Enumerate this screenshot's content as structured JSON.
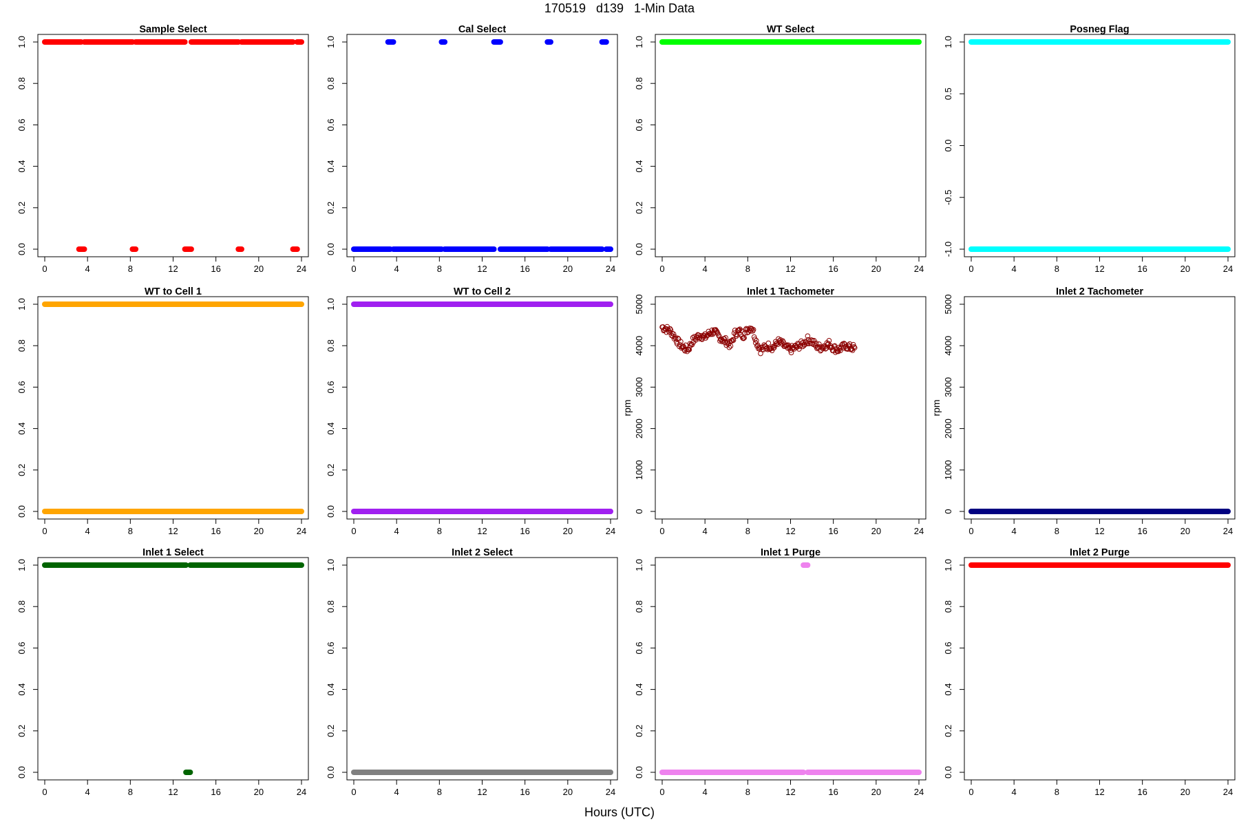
{
  "page": {
    "title": "170519   d139   1-Min Data",
    "xlabel": "Hours (UTC)"
  },
  "chart_data": [
    {
      "type": "scatter",
      "title": "Sample Select",
      "color": "#ff0000",
      "xlim": [
        0,
        24
      ],
      "ylim": [
        0,
        1
      ],
      "xticks": [
        0,
        4,
        8,
        12,
        16,
        20,
        24
      ],
      "yticks": [
        "0.0",
        "0.2",
        "0.4",
        "0.6",
        "0.8",
        "1.0"
      ],
      "ylabel": "",
      "series": [
        {
          "y": 1,
          "ranges": [
            [
              0,
              3.4
            ],
            [
              3.7,
              8.2
            ],
            [
              8.5,
              13.1
            ],
            [
              13.7,
              18.1
            ],
            [
              18.4,
              23.2
            ],
            [
              23.6,
              24
            ]
          ]
        },
        {
          "y": 0,
          "ranges": [
            [
              3.2,
              3.7
            ],
            [
              8.2,
              8.5
            ],
            [
              13.1,
              13.7
            ],
            [
              18.1,
              18.4
            ],
            [
              23.2,
              23.6
            ]
          ]
        }
      ]
    },
    {
      "type": "scatter",
      "title": "Cal Select",
      "color": "#0000ff",
      "xlim": [
        0,
        24
      ],
      "ylim": [
        0,
        1
      ],
      "xticks": [
        0,
        4,
        8,
        12,
        16,
        20,
        24
      ],
      "yticks": [
        "0.0",
        "0.2",
        "0.4",
        "0.6",
        "0.8",
        "1.0"
      ],
      "ylabel": "",
      "series": [
        {
          "y": 1,
          "ranges": [
            [
              3.2,
              3.7
            ],
            [
              8.2,
              8.5
            ],
            [
              13.1,
              13.7
            ],
            [
              18.1,
              18.4
            ],
            [
              23.2,
              23.6
            ]
          ]
        },
        {
          "y": 0,
          "ranges": [
            [
              0,
              3.4
            ],
            [
              3.7,
              8.2
            ],
            [
              8.5,
              13.1
            ],
            [
              13.7,
              18.1
            ],
            [
              18.4,
              23.2
            ],
            [
              23.6,
              24
            ]
          ]
        }
      ]
    },
    {
      "type": "scatter",
      "title": "WT Select",
      "color": "#00ff00",
      "xlim": [
        0,
        24
      ],
      "ylim": [
        0,
        1
      ],
      "xticks": [
        0,
        4,
        8,
        12,
        16,
        20,
        24
      ],
      "yticks": [
        "0.0",
        "0.2",
        "0.4",
        "0.6",
        "0.8",
        "1.0"
      ],
      "ylabel": "",
      "series": [
        {
          "y": 1,
          "ranges": [
            [
              0,
              24
            ]
          ]
        }
      ]
    },
    {
      "type": "scatter",
      "title": "Posneg Flag",
      "color": "#00ffff",
      "xlim": [
        0,
        24
      ],
      "ylim": [
        -1,
        1
      ],
      "xticks": [
        0,
        4,
        8,
        12,
        16,
        20,
        24
      ],
      "yticks": [
        "-1.0",
        "-0.5",
        "0.0",
        "0.5",
        "1.0"
      ],
      "ylabel": "",
      "series": [
        {
          "y": 1,
          "ranges": [
            [
              0,
              24
            ]
          ]
        },
        {
          "y": -1,
          "ranges": [
            [
              0,
              24
            ]
          ]
        }
      ]
    },
    {
      "type": "scatter",
      "title": "WT to Cell 1",
      "color": "#ffa500",
      "xlim": [
        0,
        24
      ],
      "ylim": [
        0,
        1
      ],
      "xticks": [
        0,
        4,
        8,
        12,
        16,
        20,
        24
      ],
      "yticks": [
        "0.0",
        "0.2",
        "0.4",
        "0.6",
        "0.8",
        "1.0"
      ],
      "ylabel": "",
      "series": [
        {
          "y": 1,
          "ranges": [
            [
              0,
              24
            ]
          ]
        },
        {
          "y": 0,
          "ranges": [
            [
              0,
              24
            ]
          ]
        }
      ]
    },
    {
      "type": "scatter",
      "title": "WT to Cell 2",
      "color": "#a020f0",
      "xlim": [
        0,
        24
      ],
      "ylim": [
        0,
        1
      ],
      "xticks": [
        0,
        4,
        8,
        12,
        16,
        20,
        24
      ],
      "yticks": [
        "0.0",
        "0.2",
        "0.4",
        "0.6",
        "0.8",
        "1.0"
      ],
      "ylabel": "",
      "series": [
        {
          "y": 1,
          "ranges": [
            [
              0,
              24
            ]
          ]
        },
        {
          "y": 0,
          "ranges": [
            [
              0,
              24
            ]
          ]
        }
      ]
    },
    {
      "type": "scatter",
      "title": "Inlet 1 Tachometer",
      "color": "#8b0000",
      "xlim": [
        0,
        24
      ],
      "ylim": [
        0,
        5000
      ],
      "xticks": [
        0,
        4,
        8,
        12,
        16,
        20,
        24
      ],
      "yticks": [
        "0",
        "1000",
        "2000",
        "3000",
        "4000",
        "5000"
      ],
      "ylabel": "rpm",
      "x": [
        0,
        0.4,
        0.8,
        1.2,
        1.6,
        2.0,
        2.4,
        2.8,
        3.2,
        3.6,
        4.0,
        4.4,
        4.8,
        5.2,
        5.6,
        6.0,
        6.4,
        6.8,
        7.2,
        7.6,
        8.0,
        8.4,
        8.8,
        9.2,
        9.6,
        10.0,
        10.4,
        10.8,
        11.2,
        11.6,
        12.0,
        12.4,
        12.8,
        13.2,
        13.6,
        14.0,
        14.4,
        14.8,
        15.2,
        15.6,
        16.0,
        16.4,
        16.8,
        17.2,
        17.6,
        18.0
      ],
      "y": [
        4450,
        4400,
        4350,
        4200,
        4050,
        3950,
        3900,
        4100,
        4200,
        4250,
        4200,
        4300,
        4350,
        4250,
        4150,
        4100,
        4000,
        4300,
        4350,
        4250,
        4400,
        4450,
        4100,
        3900,
        3950,
        4000,
        3950,
        4100,
        4050,
        3950,
        3900,
        3950,
        4000,
        4050,
        4150,
        4100,
        4000,
        3950,
        4000,
        4050,
        3950,
        3900,
        3950,
        4000,
        3950,
        3950
      ],
      "spread": 180
    },
    {
      "type": "scatter",
      "title": "Inlet 2 Tachometer",
      "color": "#000080",
      "xlim": [
        0,
        24
      ],
      "ylim": [
        0,
        5000
      ],
      "xticks": [
        0,
        4,
        8,
        12,
        16,
        20,
        24
      ],
      "yticks": [
        "0",
        "1000",
        "2000",
        "3000",
        "4000",
        "5000"
      ],
      "ylabel": "rpm",
      "series": [
        {
          "y": 0,
          "ranges": [
            [
              0,
              24
            ]
          ]
        }
      ]
    },
    {
      "type": "scatter",
      "title": "Inlet 1 Select",
      "color": "#006400",
      "xlim": [
        0,
        24
      ],
      "ylim": [
        0,
        1
      ],
      "xticks": [
        0,
        4,
        8,
        12,
        16,
        20,
        24
      ],
      "yticks": [
        "0.0",
        "0.2",
        "0.4",
        "0.6",
        "0.8",
        "1.0"
      ],
      "ylabel": "",
      "series": [
        {
          "y": 1,
          "ranges": [
            [
              0,
              13.2
            ],
            [
              13.6,
              24
            ]
          ]
        },
        {
          "y": 0,
          "ranges": [
            [
              13.2,
              13.6
            ]
          ]
        }
      ]
    },
    {
      "type": "scatter",
      "title": "Inlet 2 Select",
      "color": "#808080",
      "xlim": [
        0,
        24
      ],
      "ylim": [
        0,
        1
      ],
      "xticks": [
        0,
        4,
        8,
        12,
        16,
        20,
        24
      ],
      "yticks": [
        "0.0",
        "0.2",
        "0.4",
        "0.6",
        "0.8",
        "1.0"
      ],
      "ylabel": "",
      "series": [
        {
          "y": 0,
          "ranges": [
            [
              0,
              24
            ]
          ]
        }
      ]
    },
    {
      "type": "scatter",
      "title": "Inlet 1 Purge",
      "color": "#ee82ee",
      "xlim": [
        0,
        24
      ],
      "ylim": [
        0,
        1
      ],
      "xticks": [
        0,
        4,
        8,
        12,
        16,
        20,
        24
      ],
      "yticks": [
        "0.0",
        "0.2",
        "0.4",
        "0.6",
        "0.8",
        "1.0"
      ],
      "ylabel": "",
      "series": [
        {
          "y": 1,
          "ranges": [
            [
              13.2,
              13.6
            ]
          ]
        },
        {
          "y": 0,
          "ranges": [
            [
              0,
              13.2
            ],
            [
              13.6,
              24
            ]
          ]
        }
      ]
    },
    {
      "type": "scatter",
      "title": "Inlet 2 Purge",
      "color": "#ff0000",
      "xlim": [
        0,
        24
      ],
      "ylim": [
        0,
        1
      ],
      "xticks": [
        0,
        4,
        8,
        12,
        16,
        20,
        24
      ],
      "yticks": [
        "0.0",
        "0.2",
        "0.4",
        "0.6",
        "0.8",
        "1.0"
      ],
      "ylabel": "",
      "series": [
        {
          "y": 1,
          "ranges": [
            [
              0,
              24
            ]
          ]
        }
      ]
    }
  ]
}
